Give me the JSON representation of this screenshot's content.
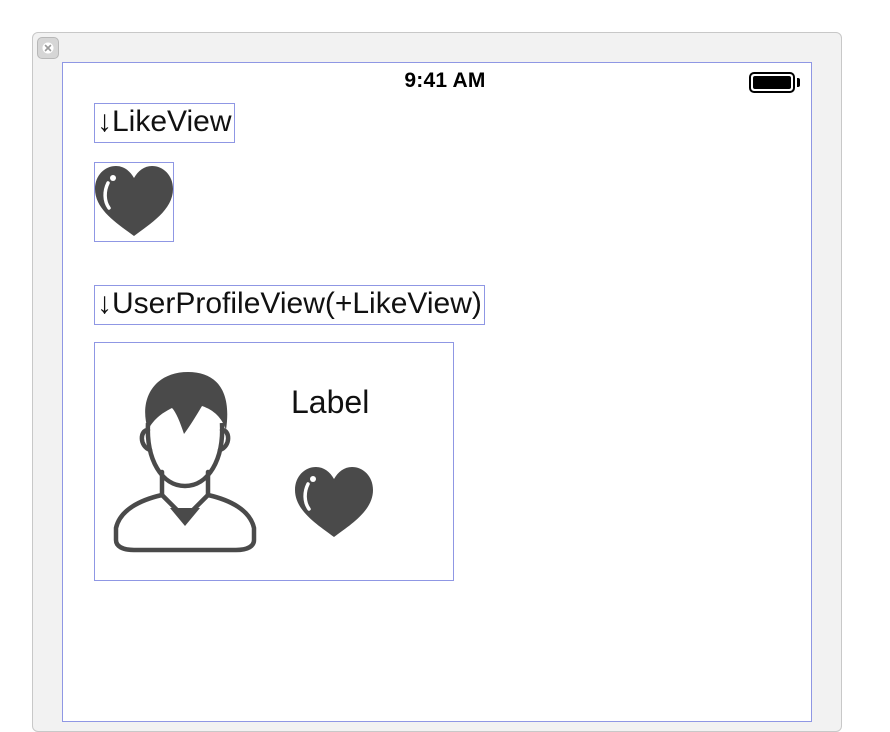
{
  "status_bar": {
    "time": "9:41 AM"
  },
  "like_section": {
    "title": "↓LikeView"
  },
  "profile_section": {
    "title": "↓UserProfileView(+LikeView)",
    "name_label": "Label"
  },
  "icons": {
    "close": "close-icon",
    "heart": "heart-icon",
    "user": "user-avatar-icon",
    "battery": "battery-icon"
  },
  "colors": {
    "outline": "#8f97e4",
    "icon_fill": "#4a4a4a"
  }
}
